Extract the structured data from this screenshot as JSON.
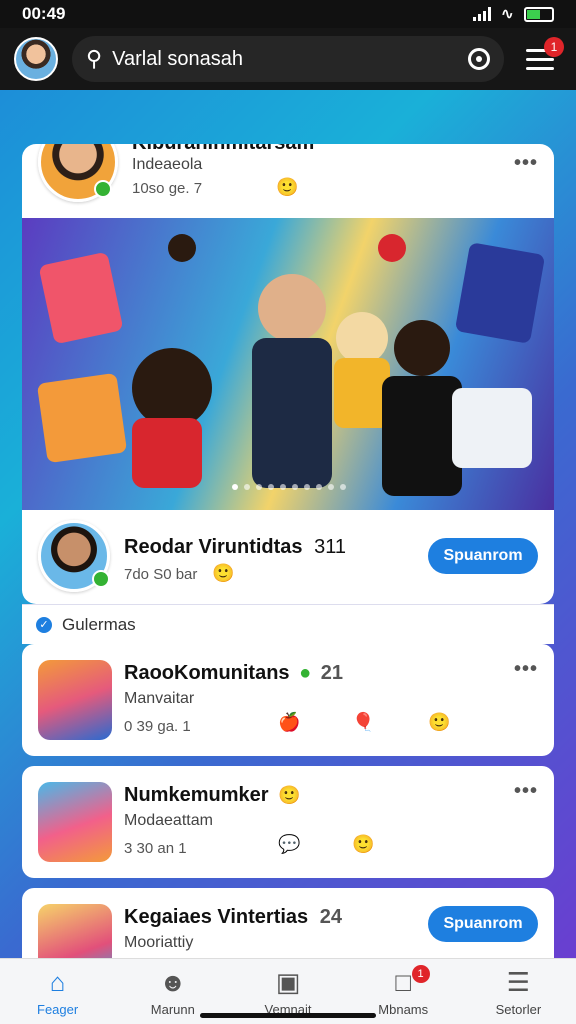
{
  "status_bar": {
    "time": "00:49"
  },
  "top_bar": {
    "search_text": "Varlal sonasah",
    "menu_badge": "1"
  },
  "post": {
    "author": "Kiburaninmitarsam",
    "location": "Indeaeola",
    "meta": "10so ge. 7",
    "banner_dots": 10,
    "banner_active_dot": 0
  },
  "featured": {
    "name": "Reodar Viruntidtas",
    "count": "311",
    "meta": "7do S0 bar",
    "button": "Spuanrom"
  },
  "section": {
    "title": "Gulermas"
  },
  "items": [
    {
      "name": "RaooKomunitans",
      "count": "21",
      "sub": "Manvaitar",
      "meta": "0 39 ga. 1"
    },
    {
      "name": "Numkemumker",
      "sub": "Modaeattam",
      "meta": "3 30 an 1"
    },
    {
      "name": "Kegaiaes Vintertias",
      "count": "24",
      "sub": "Mooriattiy",
      "button": "Spuanrom"
    }
  ],
  "nav": [
    {
      "label": "Feager",
      "icon": "home-icon",
      "active": true
    },
    {
      "label": "Marunn",
      "icon": "group-icon"
    },
    {
      "label": "Vemnait",
      "icon": "gallery-icon"
    },
    {
      "label": "Mbnams",
      "icon": "notifications-icon",
      "badge": "1"
    },
    {
      "label": "Setorler",
      "icon": "menu-icon"
    }
  ]
}
